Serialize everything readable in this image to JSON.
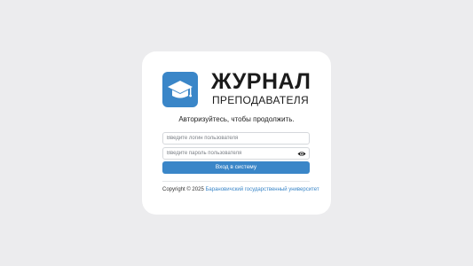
{
  "logo": {
    "title": "ЖУРНАЛ",
    "subtitle": "ПРЕПОДАВАТЕЛЯ",
    "icon": "graduation-cap-icon",
    "badge_color": "#3a86c8"
  },
  "login_form": {
    "prompt": "Авторизуйтесь, чтобы продолжить.",
    "login_placeholder": "Введите логин пользователя",
    "login_value": "",
    "password_placeholder": "Введите пароль пользователя",
    "password_value": "",
    "password_toggle_icon": "eye-icon",
    "submit_label": "Вход в систему"
  },
  "footer": {
    "copyright_prefix": "Copyright © 2025",
    "university_link": "Барановичский государственный университет"
  },
  "colors": {
    "accent": "#3a86c8",
    "background": "#ececee",
    "card": "#ffffff"
  }
}
